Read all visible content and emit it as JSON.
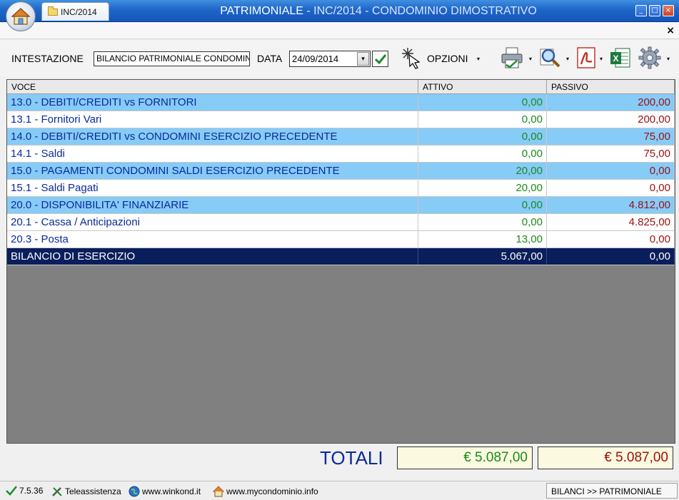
{
  "window": {
    "tab_label": "INC/2014",
    "title": "PATRIMONIALE",
    "title_sub": " - INC/2014 - CONDOMINIO DIMOSTRATIVO",
    "minimize_glyph": "_",
    "maximize_glyph": "□",
    "close_glyph": "×",
    "doc_close_glyph": "×"
  },
  "toolbar": {
    "intestazione_label": "INTESTAZIONE",
    "intestazione_value": "BILANCIO PATRIMONIALE CONDOMINIO",
    "data_label": "DATA",
    "data_value": "24/09/2014",
    "opzioni_label": "OPZIONI",
    "caret": "▾"
  },
  "table": {
    "headers": [
      "VOCE",
      "ATTIVO",
      "PASSIVO"
    ],
    "rows": [
      {
        "voce": "13.0 - DEBITI/CREDITI vs FORNITORI",
        "attivo": "0,00",
        "passivo": "200,00"
      },
      {
        "voce": "13.1 - Fornitori Vari",
        "attivo": "0,00",
        "passivo": "200,00"
      },
      {
        "voce": "14.0 - DEBITI/CREDITI vs CONDOMINI ESERCIZIO PRECEDENTE",
        "attivo": "0,00",
        "passivo": "75,00"
      },
      {
        "voce": "14.1 - Saldi",
        "attivo": "0,00",
        "passivo": "75,00"
      },
      {
        "voce": "15.0 - PAGAMENTI CONDOMINI SALDI ESERCIZIO PRECEDENTE",
        "attivo": "20,00",
        "passivo": "0,00"
      },
      {
        "voce": "15.1 - Saldi Pagati",
        "attivo": "20,00",
        "passivo": "0,00"
      },
      {
        "voce": "20.0 - DISPONIBILITA' FINANZIARIE",
        "attivo": "0,00",
        "passivo": "4.812,00"
      },
      {
        "voce": "20.1 - Cassa / Anticipazioni",
        "attivo": "0,00",
        "passivo": "4.825,00"
      },
      {
        "voce": "20.3 - Posta",
        "attivo": "13,00",
        "passivo": "0,00"
      },
      {
        "voce": "BILANCIO DI ESERCIZIO",
        "attivo": "5.067,00",
        "passivo": "0,00"
      }
    ]
  },
  "totals": {
    "label": "TOTALI",
    "attivo": "€ 5.087,00",
    "passivo": "€ 5.087,00"
  },
  "statusbar": {
    "version": "7.5.36",
    "teleassistenza": "Teleassistenza",
    "site1": "www.winkond.it",
    "site2": "www.mycondominio.info",
    "breadcrumb": "BILANCI >> PATRIMONIALE"
  },
  "colors": {
    "titlebar": "#1f66c9",
    "group_row": "#87cbf7",
    "total_row": "#0a1e5c",
    "attivo_text": "#1b8a1b",
    "passivo_text": "#9b1010"
  }
}
